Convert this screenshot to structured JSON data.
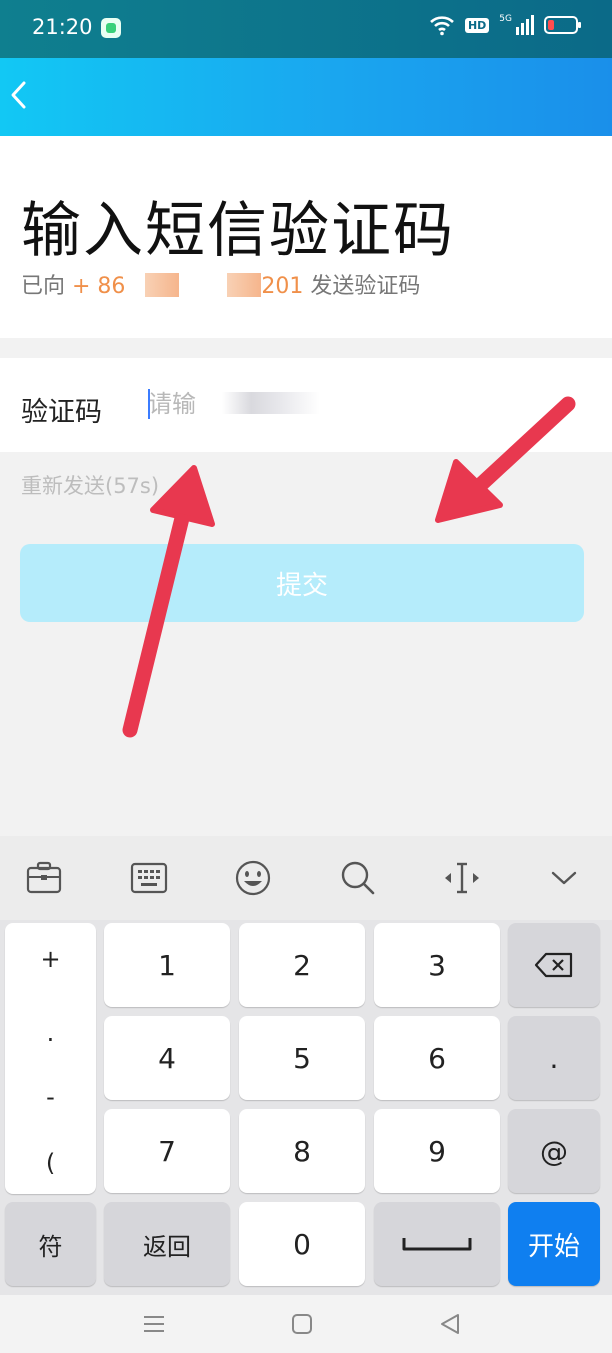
{
  "status_bar": {
    "time": "21:20",
    "network": "5G",
    "hd": "HD"
  },
  "header": {
    "back_icon": "chevron-left-icon"
  },
  "page": {
    "title": "输入短信验证码",
    "subtitle_prefix": "已向 ",
    "phone_prefix": "+ 86",
    "phone_suffix": "201",
    "subtitle_suffix": " 发送验证码"
  },
  "form": {
    "code_label": "验证码",
    "code_placeholder": "请输",
    "resend_label": "重新发送(57s)",
    "submit_label": "提交"
  },
  "keyboard": {
    "toolbar_icons": [
      "clipboard-icon",
      "keyboard-icon",
      "emoji-icon",
      "search-icon",
      "cursor-icon",
      "chevron-down-icon"
    ],
    "symbols": [
      "+",
      ".",
      "-",
      "("
    ],
    "keys": [
      "1",
      "2",
      "3",
      "4",
      "5",
      "6",
      "7",
      "8",
      "9",
      "0",
      ".",
      "@"
    ],
    "symbol_key": "符",
    "back_key": "返回",
    "start_key": "开始"
  },
  "colors": {
    "accent": "#1aa6ef",
    "submit_disabled": "#b5ecfb",
    "start_key": "#0f7ff0",
    "arrow": "#e8384f",
    "phone": "#f0904a"
  }
}
